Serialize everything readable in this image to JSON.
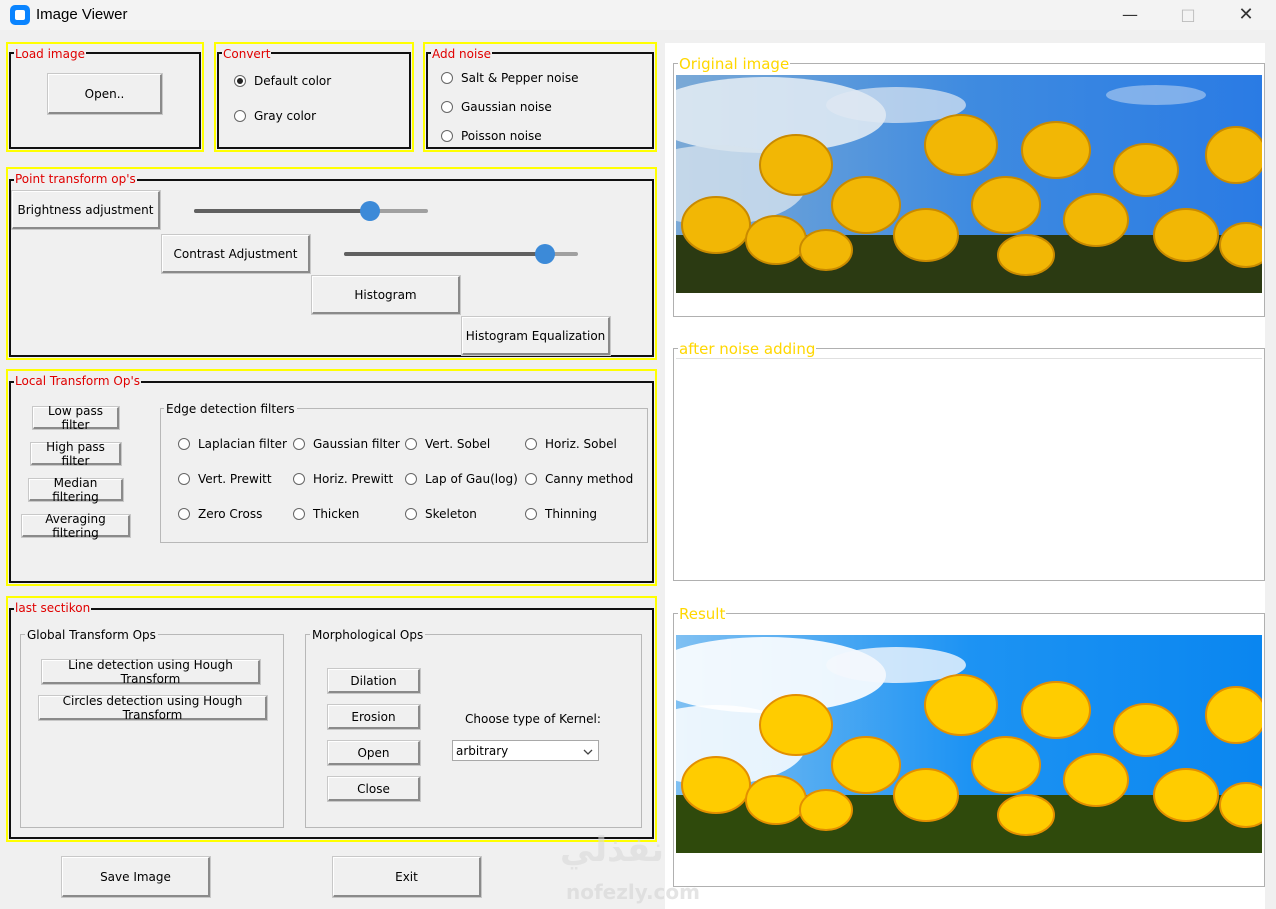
{
  "window": {
    "title": "Image Viewer",
    "minimize": "—",
    "maximize": "□",
    "close": "✕",
    "app_icon": "app-icon"
  },
  "load_image": {
    "label": "Load image",
    "open_button": "Open.."
  },
  "convert": {
    "label": "Convert",
    "options": [
      "Default color",
      "Gray color"
    ],
    "selected": "Default color"
  },
  "add_noise": {
    "label": "Add noise",
    "options": [
      "Salt & Pepper noise",
      "Gaussian noise",
      "Poisson noise"
    ]
  },
  "point_transform": {
    "label": "Point transform op's",
    "brightness_button": "Brightness adjustment",
    "brightness_level": 0.75,
    "contrast_button": "Contrast Adjustment",
    "contrast_level": 0.86,
    "histogram_button": "Histogram",
    "histogram_eq_button": "Histogram Equalization"
  },
  "local_transform": {
    "label": "Local Transform Op's",
    "buttons": [
      "Low pass filter",
      "High pass filter",
      "Median filtering",
      "Averaging filtering"
    ],
    "edge_detection": {
      "label": "Edge detection filters",
      "options": [
        [
          "Laplacian filter",
          "Gaussian filter",
          "Vert. Sobel",
          "Horiz. Sobel"
        ],
        [
          "Vert. Prewitt",
          "Horiz. Prewitt",
          "Lap of Gau(log)",
          "Canny method"
        ],
        [
          "Zero Cross",
          "Thicken",
          "Skeleton",
          "Thinning"
        ]
      ]
    }
  },
  "last_section": {
    "label": "last sectikon",
    "global": {
      "label": "Global Transform Ops",
      "buttons": [
        "Line detection using Hough Transform",
        "Circles detection using Hough Transform"
      ]
    },
    "morph": {
      "label": "Morphological Ops",
      "buttons": [
        "Dilation",
        "Erosion",
        "Open",
        "Close"
      ],
      "kernel_label": "Choose type of Kernel:",
      "kernel_value": "arbitrary"
    }
  },
  "bottom": {
    "save_button": "Save Image",
    "exit_button": "Exit"
  },
  "images": {
    "original_label": "Original image",
    "noise_label": "after noise adding",
    "result_label": "Result"
  },
  "watermark": {
    "text": "نفذلي",
    "url": "nofezly.com"
  },
  "colors": {
    "frame_yellow": "#ffff00",
    "label_red": "#e00000",
    "image_label_yellow": "#ffd700",
    "slider_blue": "#3c8ad8"
  }
}
